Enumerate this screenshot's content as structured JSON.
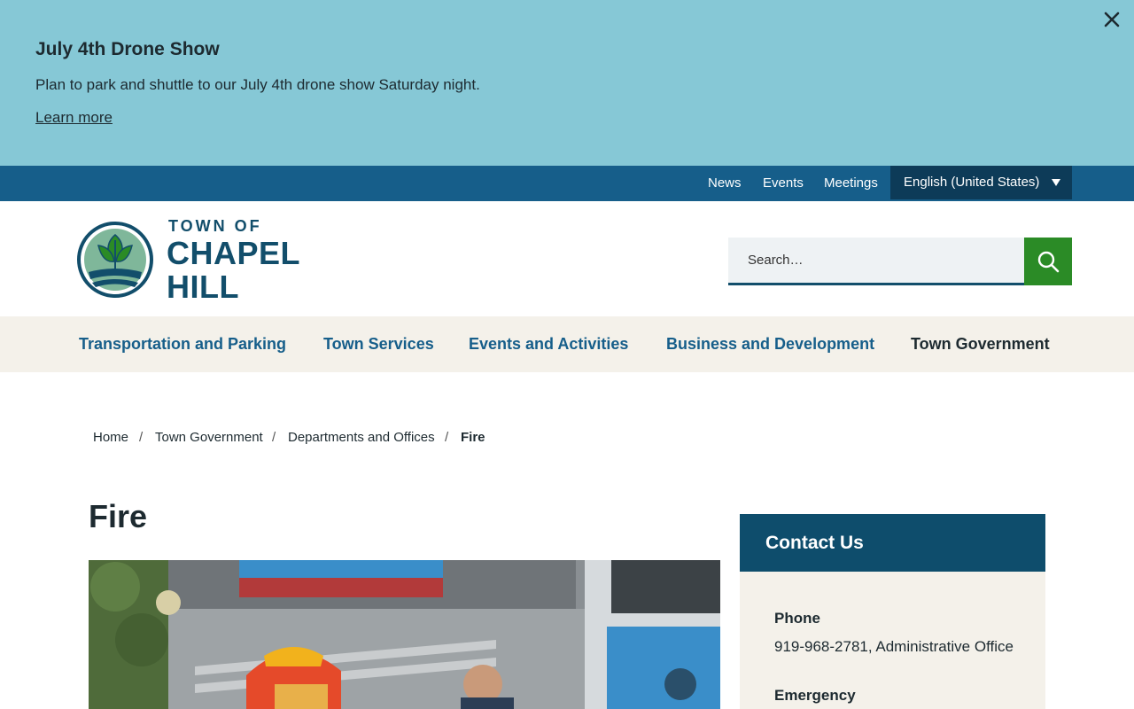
{
  "alert": {
    "title": "July 4th Drone Show",
    "text": "Plan to park and shuttle to our July 4th drone show Saturday night.",
    "link": "Learn more",
    "close_icon": "close-icon",
    "background": "#86c8d6"
  },
  "utility": {
    "links": [
      "News",
      "Events",
      "Meetings"
    ],
    "language": "English (United States)",
    "background": "#165e8a"
  },
  "logo": {
    "line1": "TOWN OF",
    "line2": "CHAPEL",
    "line3": "HILL",
    "icon": "tree-logo-icon"
  },
  "search": {
    "placeholder": "Search…",
    "icon": "search-icon",
    "button_color": "#2b8b26"
  },
  "nav": {
    "items": [
      "Transportation and Parking",
      "Town Services",
      "Events and Activities",
      "Business and Development",
      "Town Government"
    ]
  },
  "breadcrumb": {
    "items": [
      "Home",
      "Town Government",
      "Departments and Offices"
    ],
    "current": "Fire",
    "separator": "/"
  },
  "page": {
    "title": "Fire"
  },
  "contact": {
    "heading": "Contact Us",
    "phone_label": "Phone",
    "phone_value": "919-968-2781, Administrative Office",
    "emergency_label": "Emergency"
  }
}
